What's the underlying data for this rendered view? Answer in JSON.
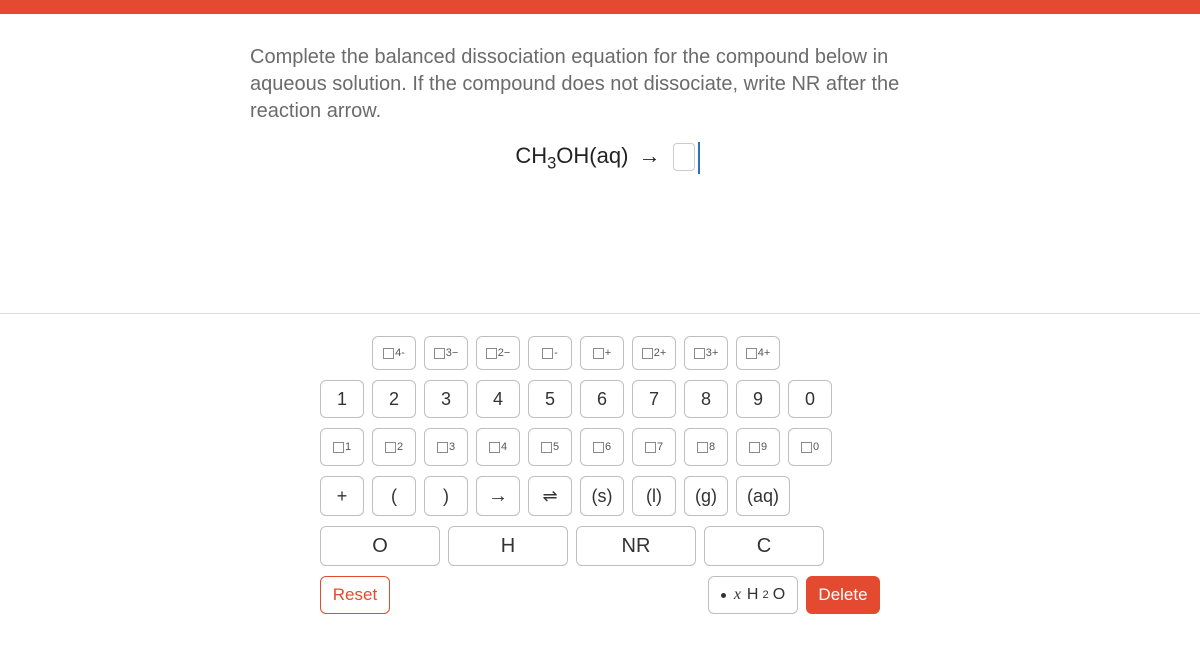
{
  "question": "Complete the balanced dissociation equation for the compound below in aqueous solution. If the compound does not dissociate, write NR after the reaction arrow.",
  "equation": {
    "compound_prefix": "CH",
    "compound_sub": "3",
    "compound_suffix": "OH(aq)",
    "arrow": "→"
  },
  "charges": {
    "c4m": "4-",
    "c3m": "3−",
    "c2m": "2−",
    "c1m": "-",
    "c1p": "+",
    "c2p": "2+",
    "c3p": "3+",
    "c4p": "4+"
  },
  "digits": [
    "1",
    "2",
    "3",
    "4",
    "5",
    "6",
    "7",
    "8",
    "9",
    "0"
  ],
  "subscripts": [
    "1",
    "2",
    "3",
    "4",
    "5",
    "6",
    "7",
    "8",
    "9",
    "0"
  ],
  "ops": {
    "plus": "+",
    "lparen": "(",
    "rparen": ")",
    "fwd_arrow": "→",
    "equil": "⇌"
  },
  "states": {
    "s": "(s)",
    "l": "(l)",
    "g": "(g)",
    "aq": "(aq)"
  },
  "elements": {
    "O": "O",
    "H": "H",
    "NR": "NR",
    "C": "C"
  },
  "water": {
    "x": "x",
    "h2o_h": "H",
    "h2o_sub": "2",
    "h2o_o": "O"
  },
  "actions": {
    "reset": "Reset",
    "delete": "Delete"
  }
}
